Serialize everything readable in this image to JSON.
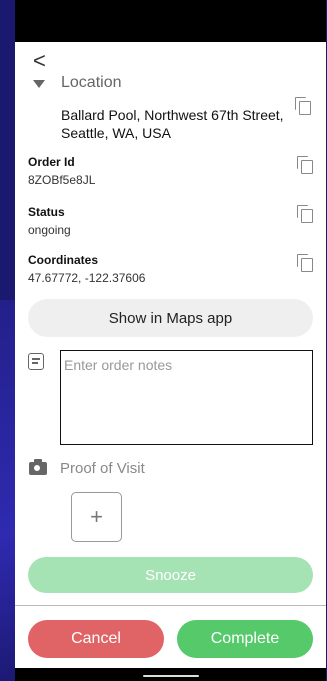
{
  "nav": {
    "back_glyph": "<"
  },
  "location": {
    "title": "Location",
    "address": "Ballard Pool, Northwest 67th Street, Seattle, WA, USA"
  },
  "fields": [
    {
      "label": "Order Id",
      "value": "8ZOBf5e8JL"
    },
    {
      "label": "Status",
      "value": "ongoing"
    },
    {
      "label": "Coordinates",
      "value": "47.67772, -122.37606"
    }
  ],
  "maps_button": "Show in Maps app",
  "notes": {
    "placeholder": "Enter order notes"
  },
  "proof": {
    "label": "Proof of Visit",
    "add_glyph": "+"
  },
  "actions": {
    "snooze": "Snooze",
    "cancel": "Cancel",
    "complete": "Complete"
  },
  "colors": {
    "cancel": "#e06365",
    "complete": "#56c96b",
    "snooze": "#a5e3b4",
    "backdrop": "#1b1870"
  },
  "icons": [
    "back-arrow-icon",
    "collapse-triangle-icon",
    "copy-icon",
    "notes-icon",
    "camera-icon",
    "plus-icon"
  ]
}
